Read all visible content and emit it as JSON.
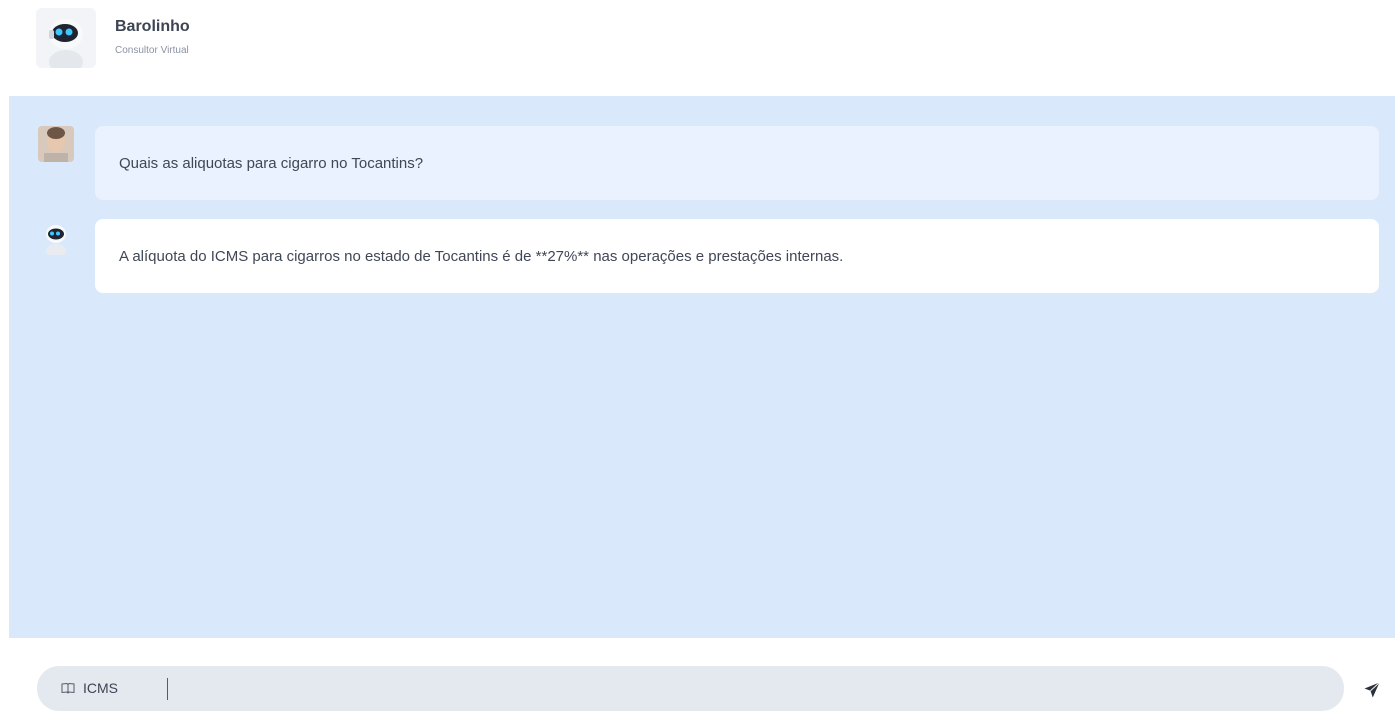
{
  "header": {
    "name": "Barolinho",
    "subtitle": "Consultor Virtual"
  },
  "messages": [
    {
      "role": "user",
      "text": "Quais as aliquotas para cigarro no Tocantins?"
    },
    {
      "role": "bot",
      "text": "A alíquota do ICMS para cigarros no estado de Tocantins é de **27%** nas operações e prestações internas."
    }
  ],
  "input": {
    "mode_label": "ICMS",
    "value": "",
    "mode_icon": "book-icon",
    "send_icon": "send-icon"
  },
  "colors": {
    "chat_background": "#dae8fc",
    "user_bubble": "#e9f2fe",
    "bot_bubble": "#ffffff",
    "input_background": "#e4e8ef"
  }
}
